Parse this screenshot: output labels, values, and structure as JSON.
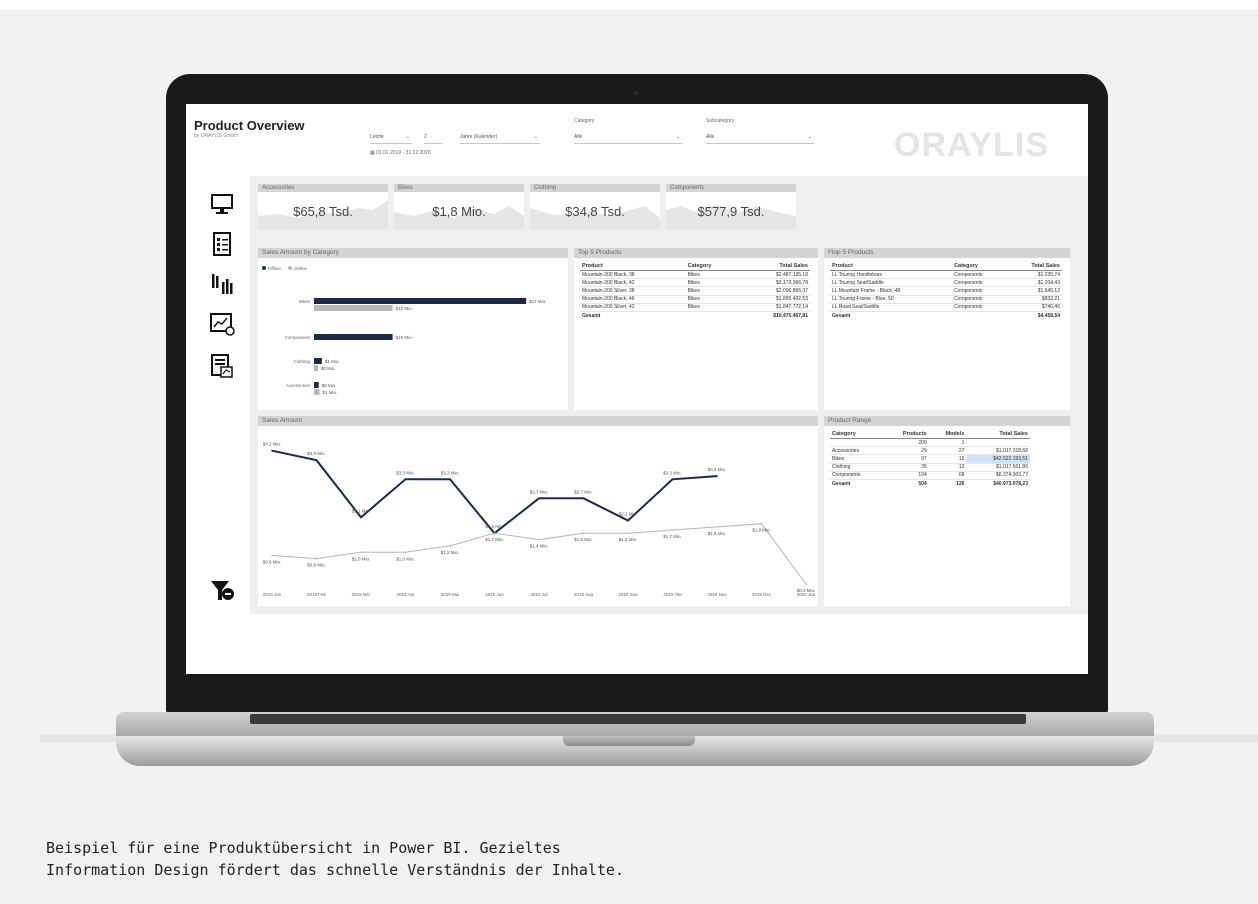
{
  "caption": {
    "line1": "Beispiel für eine Produktübersicht in Power BI. Gezieltes",
    "line2": "Information Design fördert das schnelle Verständnis der Inhalte."
  },
  "dashboard": {
    "title": "Product Overview",
    "subtitle": "by ORAYLIS GmbH",
    "brand": "ORAYLIS",
    "date_filter": {
      "mode": "Letzte",
      "count": "2",
      "unit": "Jahre (Kalender)",
      "range": "01.01.2019 - 31.12.2020"
    },
    "category_filter": {
      "label": "Category",
      "value": "Alle"
    },
    "subcategory_filter": {
      "label": "Subcategory",
      "value": "Alle"
    },
    "nav_icons": [
      "monitor-icon",
      "checklist-icon",
      "bar-chart-icon",
      "line-report-icon",
      "document-report-icon",
      "filter-clear-icon"
    ],
    "kpis": [
      {
        "label": "Accessories",
        "value": "$65,8 Tsd."
      },
      {
        "label": "Bikes",
        "value": "$1,8 Mio."
      },
      {
        "label": "Clothing",
        "value": "$34,8 Tsd."
      },
      {
        "label": "Components",
        "value": "$577,9 Tsd."
      }
    ],
    "sales_by_category": {
      "title": "Sales Amount by Category",
      "legend": [
        "Offline",
        "Online"
      ]
    },
    "top5": {
      "title": "Top 5 Products",
      "headers": [
        "Product",
        "Category",
        "Total Sales"
      ],
      "rows": [
        [
          "Mountain-200 Black, 38",
          "Bikes",
          "$2.487.195,18"
        ],
        [
          "Mountain-200 Black, 42",
          "Bikes",
          "$2.172.366,78"
        ],
        [
          "Mountain-200 Silver, 38",
          "Bikes",
          "$2.096.866,37"
        ],
        [
          "Mountain-200 Black, 46",
          "Bikes",
          "$1.895.402,53"
        ],
        [
          "Mountain-200 Silver, 42",
          "Bikes",
          "$1.847.772,14"
        ]
      ],
      "total": [
        "Gesamt",
        "",
        "$10.475.467,81"
      ]
    },
    "flop5": {
      "title": "Flop 5 Products",
      "headers": [
        "Product",
        "Category",
        "Total Sales"
      ],
      "rows": [
        [
          "LL Touring Handlebars",
          "Components",
          "$1.235,74"
        ],
        [
          "LL Touring Seat/Saddle",
          "Components",
          "$1.204,43"
        ],
        [
          "LL Mountain Frame - Black, 48",
          "Components",
          "$1.645,12"
        ],
        [
          "LL Touring Frame - Blue, 50",
          "Components",
          "$832,21"
        ],
        [
          "LL Road Seat/Saddle",
          "Components",
          "$746,46"
        ]
      ],
      "total": [
        "Gesamt",
        "",
        "$4.458,54"
      ]
    },
    "sales_amount": {
      "title": "Sales Amount"
    },
    "product_range": {
      "title": "Product Range",
      "headers": [
        "Category",
        "Products",
        "Models",
        "Total Sales"
      ],
      "rows": [
        [
          "",
          "209",
          "1",
          ""
        ],
        [
          "Accessories",
          "29",
          "27",
          "$1.017.318,68"
        ],
        [
          "Bikes",
          "97",
          "15",
          "$42.522.193,51"
        ],
        [
          "Clothing",
          "35",
          "12",
          "$1.017.561,86"
        ],
        [
          "Components",
          "134",
          "68",
          "$6.374.303,77"
        ]
      ],
      "total": [
        "Gesamt",
        "504",
        "126",
        "$40.973.078,23"
      ]
    }
  },
  "chart_data": [
    {
      "type": "bar",
      "title": "Sales Amount by Category",
      "categories": [
        "Bikes",
        "Components",
        "Clothing",
        "Accessories"
      ],
      "series": [
        {
          "name": "Offline",
          "values": [
            27,
            10,
            1,
            0.6
          ]
        },
        {
          "name": "Online",
          "values": [
            10,
            0,
            0.5,
            0.7
          ]
        }
      ],
      "data_labels": {
        "Offline": [
          "$27 Mio.",
          "$10 Mio.",
          "$1 Mio.",
          "$0 Mio."
        ],
        "Online": [
          "$10 Mio.",
          "",
          "$0 Mio.",
          "$1 Mio."
        ]
      },
      "xlim": [
        0,
        28
      ],
      "legend": "top-left"
    },
    {
      "type": "line",
      "title": "Sales Amount",
      "x": [
        "2019 Jan",
        "2019 Feb",
        "2019 Mrz",
        "2019 Apr",
        "2019 Mai",
        "2019 Jun",
        "2019 Jul",
        "2019 Aug",
        "2019 Sep",
        "2019 Okt",
        "2019 Nov",
        "2019 Dez",
        "2020 Jan"
      ],
      "series": [
        {
          "color": "#1b2a4a",
          "values": [
            4.2,
            3.9,
            2.1,
            3.3,
            3.3,
            1.6,
            2.7,
            2.7,
            2.0,
            3.3,
            3.4,
            null,
            null
          ],
          "labels": [
            "$4,2 Mio.",
            "$3,9 Mio.",
            "$2,1 Mio.",
            "$3,3 Mio.",
            "$3,3 Mio.",
            "$1,6 Mio.",
            "$2,7 Mio.",
            "$2,7 Mio.",
            "$2,2 Mio.",
            "$3,3 Mio.",
            "$3,4 Mio.",
            "",
            ""
          ]
        },
        {
          "color": "#b5b5b5",
          "values": [
            0.9,
            0.8,
            1.0,
            1.0,
            1.2,
            1.6,
            1.4,
            1.6,
            1.6,
            1.7,
            1.8,
            1.9,
            0.0
          ],
          "labels": [
            "$0,9 Mio.",
            "$0,8 Mio.",
            "$1,0 Mio.",
            "$1,0 Mio.",
            "$1,2 Mio.",
            "$1,7 Mio.",
            "$1,4 Mio.",
            "$1,6 Mio.",
            "$1,6 Mio.",
            "$1,7 Mio.",
            "$1,8 Mio.",
            "$1,9 Mio.",
            "$0,0 Mio."
          ]
        }
      ],
      "ylim": [
        0,
        4.6
      ],
      "grid": false
    }
  ]
}
